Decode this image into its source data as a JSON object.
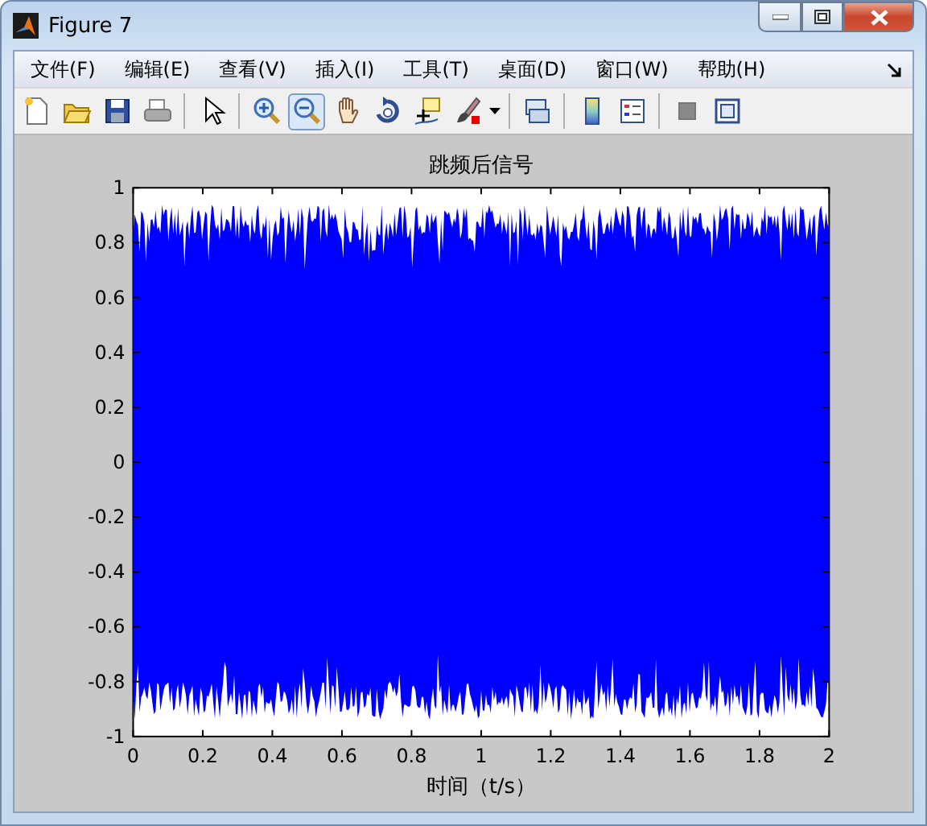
{
  "window": {
    "title": "Figure 7"
  },
  "menu": [
    {
      "label": "文件(F)"
    },
    {
      "label": "编辑(E)"
    },
    {
      "label": "查看(V)"
    },
    {
      "label": "插入(I)"
    },
    {
      "label": "工具(T)"
    },
    {
      "label": "桌面(D)"
    },
    {
      "label": "窗口(W)"
    },
    {
      "label": "帮助(H)"
    }
  ],
  "toolbar": [
    {
      "kind": "new",
      "selected": false
    },
    {
      "kind": "open",
      "selected": false
    },
    {
      "kind": "save",
      "selected": false
    },
    {
      "kind": "print",
      "selected": false
    },
    {
      "kind": "sep"
    },
    {
      "kind": "pointer",
      "selected": false
    },
    {
      "kind": "sep"
    },
    {
      "kind": "zoomin",
      "selected": false
    },
    {
      "kind": "zoomout",
      "selected": true
    },
    {
      "kind": "pan",
      "selected": false
    },
    {
      "kind": "rotate",
      "selected": false
    },
    {
      "kind": "cursor",
      "selected": false
    },
    {
      "kind": "brush",
      "selected": false
    },
    {
      "kind": "sep"
    },
    {
      "kind": "link",
      "selected": false
    },
    {
      "kind": "sep"
    },
    {
      "kind": "colorbar",
      "selected": false
    },
    {
      "kind": "legend",
      "selected": false
    },
    {
      "kind": "sep"
    },
    {
      "kind": "hide",
      "selected": false
    },
    {
      "kind": "show",
      "selected": false
    }
  ],
  "axes": {
    "title": "跳频后信号",
    "xlabel": "时间（t/s）",
    "xticks": [
      "0",
      "0.2",
      "0.4",
      "0.6",
      "0.8",
      "1",
      "1.2",
      "1.4",
      "1.6",
      "1.8",
      "2"
    ],
    "yticks": [
      "1",
      "0.8",
      "0.6",
      "0.4",
      "0.2",
      "0",
      "-0.2",
      "-0.4",
      "-0.6",
      "-0.8",
      "-1"
    ]
  }
}
